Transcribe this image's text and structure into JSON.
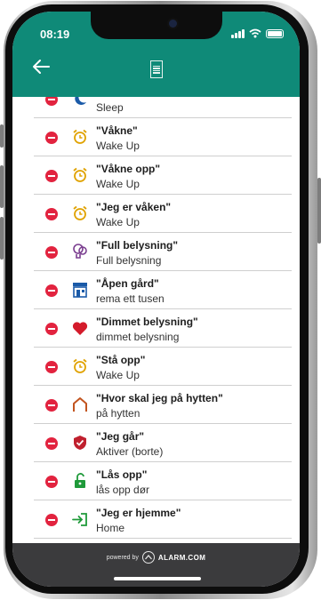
{
  "status": {
    "time": "08:19"
  },
  "colors": {
    "accent": "#0f8a78",
    "remove": "#e2233f",
    "icon_yellow": "#e0a200",
    "footer": "#3b3b3d"
  },
  "header": {
    "back_icon": "arrow-left-icon",
    "logo_icon": "app-logo-icon"
  },
  "items": [
    {
      "title": "",
      "subtitle": "Sleep",
      "icon": "moon-icon"
    },
    {
      "title": "\"Våkne\"",
      "subtitle": "Wake Up",
      "icon": "alarm-clock-icon"
    },
    {
      "title": "\"Våkne opp\"",
      "subtitle": "Wake Up",
      "icon": "alarm-clock-icon"
    },
    {
      "title": "\"Jeg er våken\"",
      "subtitle": "Wake Up",
      "icon": "alarm-clock-icon"
    },
    {
      "title": "\"Full belysning\"",
      "subtitle": "Full belysning",
      "icon": "lightbulbs-icon"
    },
    {
      "title": "\"Åpen gård\"",
      "subtitle": "rema ett tusen",
      "icon": "storefront-icon"
    },
    {
      "title": "\"Dimmet belysning\"",
      "subtitle": "dimmet belysning",
      "icon": "heart-icon"
    },
    {
      "title": "\"Stå opp\"",
      "subtitle": "Wake Up",
      "icon": "alarm-clock-icon"
    },
    {
      "title": "\"Hvor skal jeg på hytten\"",
      "subtitle": "på hytten",
      "icon": "house-arch-icon"
    },
    {
      "title": "\"Jeg går\"",
      "subtitle": "Aktiver (borte)",
      "icon": "shield-check-icon"
    },
    {
      "title": "\"Lås opp\"",
      "subtitle": "lås opp dør",
      "icon": "unlock-icon"
    },
    {
      "title": "\"Jeg er hjemme\"",
      "subtitle": "Home",
      "icon": "enter-home-icon"
    }
  ],
  "footer": {
    "powered_by": "powered by",
    "brand": "ALARM.COM"
  }
}
